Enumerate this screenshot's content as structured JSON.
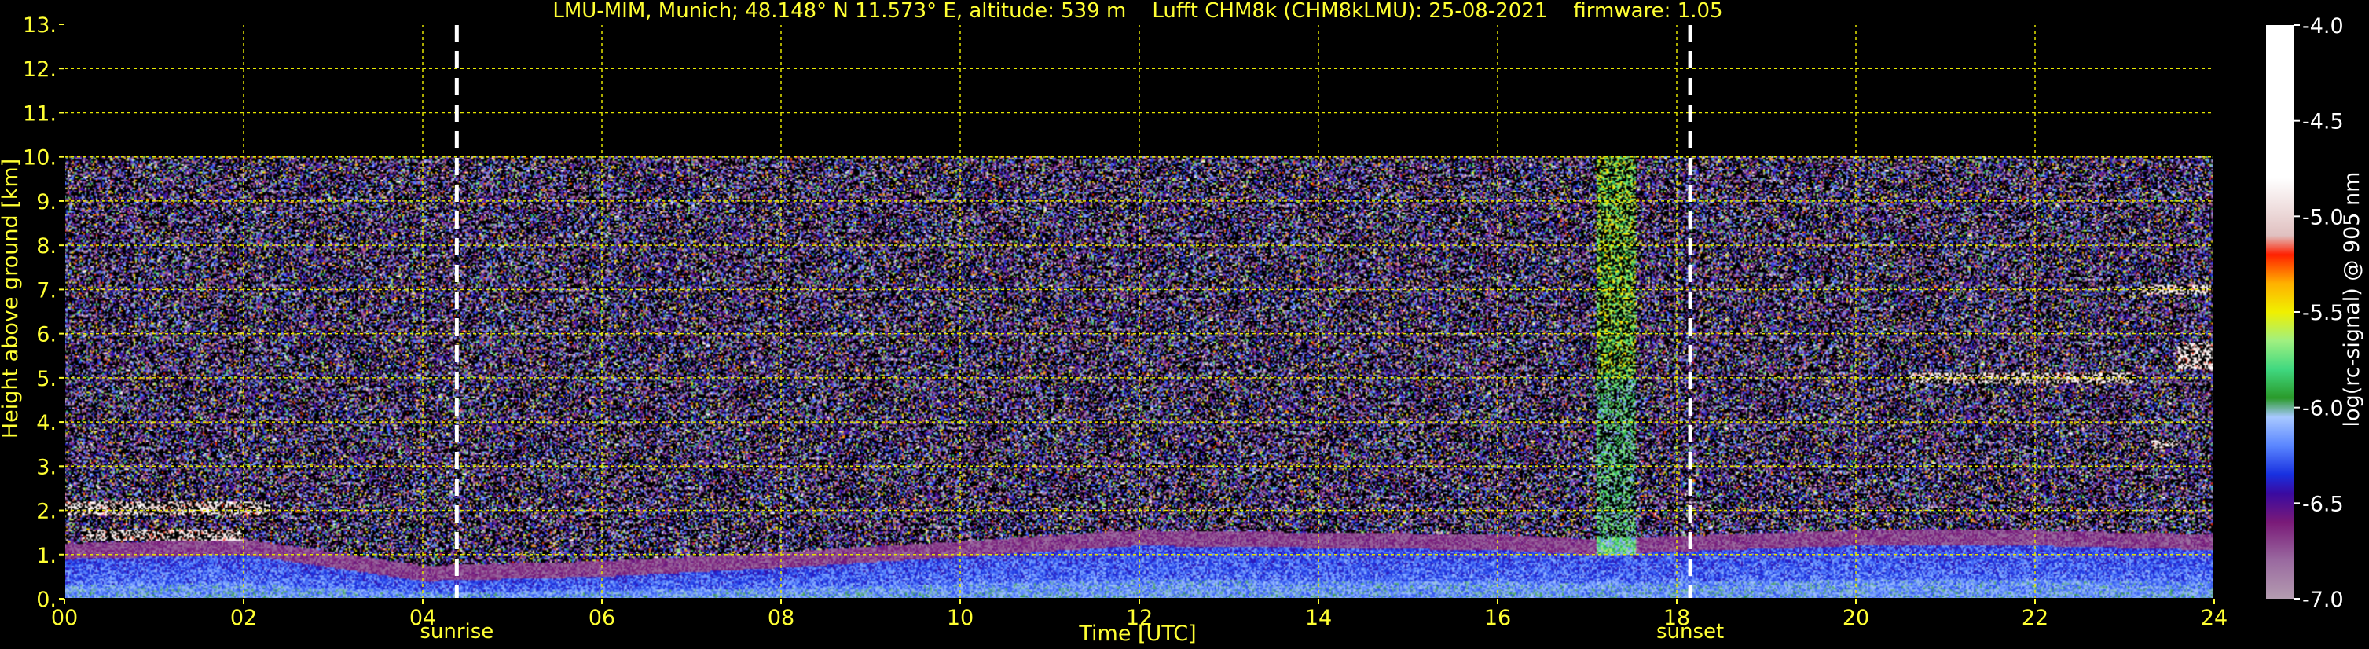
{
  "chart_data": {
    "type": "heatmap",
    "title": "LMU-MIM, Munich; 48.148° N 11.573° E, altitude: 539 m    Lufft CHM8k (CHM8kLMU): 25-08-2021    firmware: 1.05",
    "xlabel": "Time [UTC]",
    "ylabel": "Height above ground [km]",
    "xlim": [
      0,
      24
    ],
    "ylim": [
      0,
      13
    ],
    "x_ticks": [
      0,
      2,
      4,
      6,
      8,
      10,
      12,
      14,
      16,
      18,
      20,
      22,
      24
    ],
    "x_tick_labels": [
      "00",
      "02",
      "04",
      "06",
      "08",
      "10",
      "12",
      "14",
      "16",
      "18",
      "20",
      "22",
      "24"
    ],
    "y_ticks": [
      0,
      1,
      2,
      3,
      4,
      5,
      6,
      7,
      8,
      9,
      10,
      11,
      12,
      13
    ],
    "y_tick_labels": [
      "0.",
      "1.",
      "2.",
      "3.",
      "4.",
      "5.",
      "6.",
      "7.",
      "8.",
      "9.",
      "10.",
      "11.",
      "12.",
      "13."
    ],
    "grid": true,
    "grid_color": "#e6e600",
    "data_top_km": 10,
    "events": [
      {
        "label": "sunrise",
        "time": 4.38
      },
      {
        "label": "sunset",
        "time": 18.15
      }
    ],
    "colorbar": {
      "label": "log(rc-signal) @ 905 nm",
      "range": [
        -7.0,
        -4.0
      ],
      "ticks": [
        -4.0,
        -4.5,
        -5.0,
        -5.5,
        -6.0,
        -6.5,
        -7.0
      ],
      "tick_labels": [
        "-4.0",
        "-4.5",
        "-5.0",
        "-5.5",
        "-6.0",
        "-6.5",
        "-7.0"
      ],
      "stops": [
        {
          "v": -7.0,
          "c": "#b49cb0"
        },
        {
          "v": -6.8,
          "c": "#9a6aa0"
        },
        {
          "v": -6.6,
          "c": "#7a1a78"
        },
        {
          "v": -6.45,
          "c": "#3a0aa0"
        },
        {
          "v": -6.35,
          "c": "#1830e0"
        },
        {
          "v": -6.2,
          "c": "#5a86ff"
        },
        {
          "v": -6.05,
          "c": "#a8c8ff"
        },
        {
          "v": -5.95,
          "c": "#2a9a2a"
        },
        {
          "v": -5.8,
          "c": "#40d880"
        },
        {
          "v": -5.65,
          "c": "#a0f080"
        },
        {
          "v": -5.5,
          "c": "#f0f000"
        },
        {
          "v": -5.35,
          "c": "#ffb000"
        },
        {
          "v": -5.2,
          "c": "#ff2000"
        },
        {
          "v": -5.1,
          "c": "#e0c0c0"
        },
        {
          "v": -4.95,
          "c": "#f0e0e0"
        },
        {
          "v": -4.8,
          "c": "#ffffff"
        },
        {
          "v": -4.0,
          "c": "#ffffff"
        }
      ]
    },
    "features": [
      {
        "kind": "boundary_layer",
        "points": [
          [
            0,
            0.9
          ],
          [
            2,
            1.0
          ],
          [
            4,
            0.4
          ],
          [
            6,
            0.5
          ],
          [
            8,
            0.7
          ],
          [
            10,
            0.95
          ],
          [
            12,
            1.2
          ],
          [
            14,
            1.15
          ],
          [
            16,
            1.1
          ],
          [
            17,
            1.0
          ],
          [
            20,
            1.2
          ],
          [
            22,
            1.2
          ],
          [
            24,
            1.1
          ]
        ]
      },
      {
        "kind": "cloud",
        "t0": 0.0,
        "t1": 2.3,
        "h0": 1.9,
        "h1": 2.2
      },
      {
        "kind": "cloud",
        "t0": 0.2,
        "t1": 2.0,
        "h0": 1.3,
        "h1": 1.55
      },
      {
        "kind": "cloud",
        "t0": 20.6,
        "t1": 23.1,
        "h0": 4.85,
        "h1": 5.1
      },
      {
        "kind": "cloud",
        "t0": 23.2,
        "t1": 24.0,
        "h0": 6.9,
        "h1": 7.1
      },
      {
        "kind": "cloud",
        "t0": 23.6,
        "t1": 24.0,
        "h0": 5.2,
        "h1": 5.8
      },
      {
        "kind": "cloud",
        "t0": 23.3,
        "t1": 23.6,
        "h0": 3.4,
        "h1": 3.6
      },
      {
        "kind": "precip",
        "t0": 17.1,
        "t1": 17.55,
        "h0": 1.0,
        "h1": 10.0
      }
    ]
  }
}
